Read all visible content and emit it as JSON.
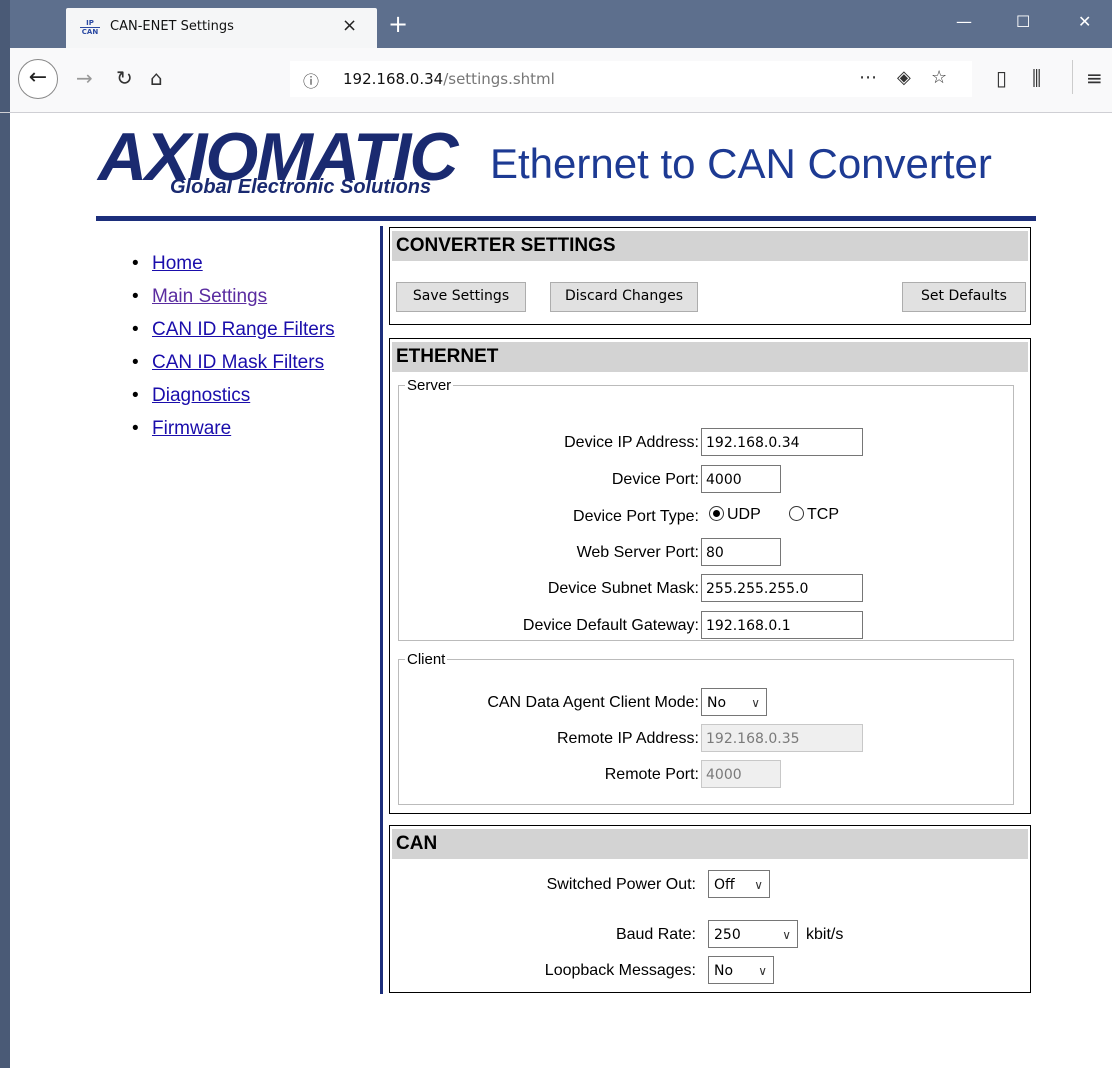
{
  "browser": {
    "tab_title": "CAN-ENET Settings",
    "favicon_text_top": "IP",
    "favicon_text_bottom": "CAN",
    "tab_close": "×",
    "new_tab": "+",
    "url_host": "192.168.0.34",
    "url_path": "/settings.shtml",
    "icons": [
      "back-arrow-icon",
      "forward-arrow-icon",
      "reload-icon",
      "home-icon",
      "info-icon",
      "more-icon",
      "pocket-icon",
      "bookmark-star-icon",
      "sidebar-icon",
      "library-icon",
      "menu-icon"
    ]
  },
  "header": {
    "logo_word": "AXIOMATIC",
    "logo_tagline": "Global Electronic Solutions",
    "title": "Ethernet to CAN Converter",
    "accent_color": "#1c2e7b"
  },
  "nav": {
    "items": [
      {
        "label": "Home"
      },
      {
        "label": "Main Settings"
      },
      {
        "label": "CAN ID Range Filters"
      },
      {
        "label": "CAN ID Mask Filters"
      },
      {
        "label": "Diagnostics"
      },
      {
        "label": "Firmware"
      }
    ]
  },
  "converter": {
    "heading": "CONVERTER SETTINGS",
    "save_label": "Save Settings",
    "discard_label": "Discard Changes",
    "defaults_label": "Set Defaults"
  },
  "ethernet": {
    "heading": "ETHERNET",
    "server": {
      "legend": "Server",
      "ip_label": "Device IP Address:",
      "ip_value": "192.168.0.34",
      "port_label": "Device Port:",
      "port_value": "4000",
      "port_type_label": "Device Port Type:",
      "port_type_options": [
        "UDP",
        "TCP"
      ],
      "port_type_selected": "UDP",
      "web_port_label": "Web Server Port:",
      "web_port_value": "80",
      "subnet_label": "Device Subnet Mask:",
      "subnet_value": "255.255.255.0",
      "gateway_label": "Device Default Gateway:",
      "gateway_value": "192.168.0.1"
    },
    "client": {
      "legend": "Client",
      "mode_label": "CAN Data Agent Client Mode:",
      "mode_value": "No",
      "remote_ip_label": "Remote IP Address:",
      "remote_ip_value": "192.168.0.35",
      "remote_port_label": "Remote Port:",
      "remote_port_value": "4000"
    }
  },
  "can": {
    "heading": "CAN",
    "power_label": "Switched Power Out:",
    "power_value": "Off",
    "baud_label": "Baud Rate:",
    "baud_value": "250",
    "baud_unit": "kbit/s",
    "loopback_label": "Loopback Messages:",
    "loopback_value": "No"
  }
}
